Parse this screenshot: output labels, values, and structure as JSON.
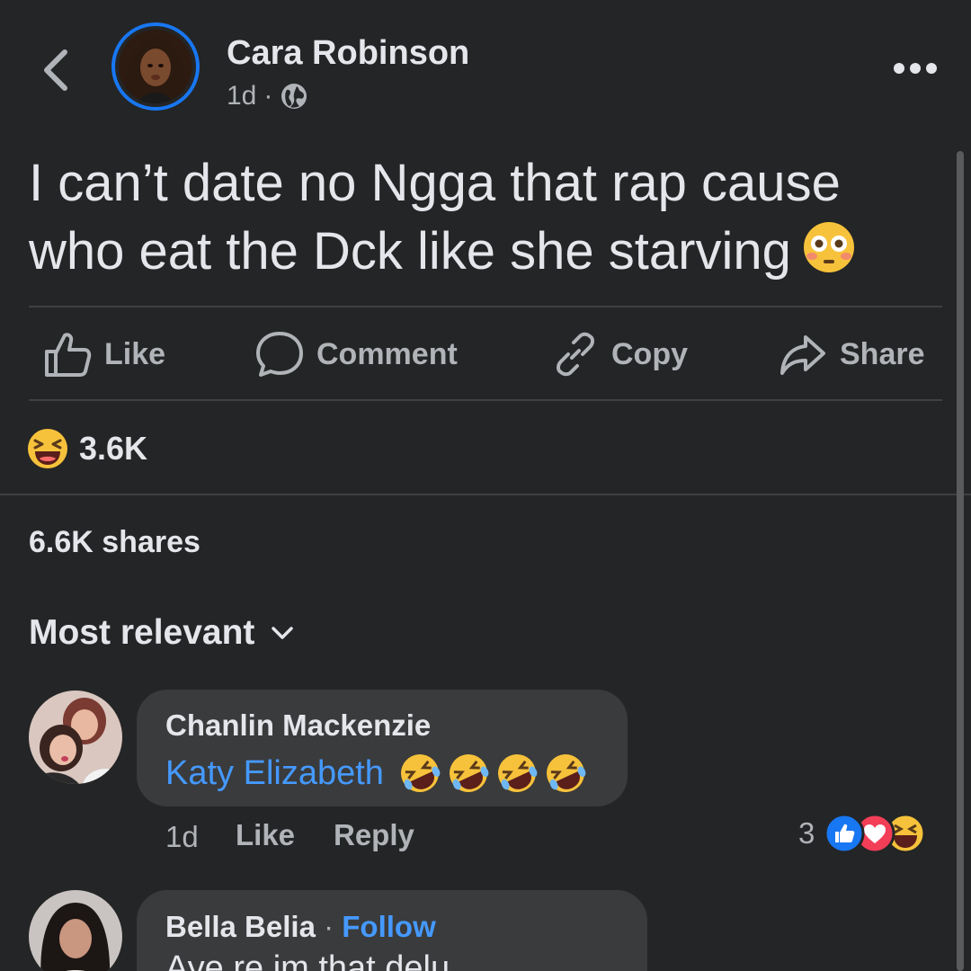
{
  "post": {
    "author": "Cara Robinson",
    "time": "1d",
    "separator": "·",
    "text": "I can’t date no Ngga that rap cause who eat the Dck like she starving",
    "text_emoji": "flushed-face-icon"
  },
  "actions": {
    "like": "Like",
    "comment": "Comment",
    "copy": "Copy",
    "share": "Share"
  },
  "reactions": {
    "icon": "laughing-face-icon",
    "count": "3.6K"
  },
  "shares": "6.6K shares",
  "sort": {
    "label": "Most relevant"
  },
  "comments": [
    {
      "author": "Chanlin Mackenzie",
      "mention": "Katy Elizabeth",
      "emojis": [
        "rofl-icon",
        "rofl-icon",
        "rofl-icon",
        "rofl-icon"
      ],
      "time": "1d",
      "like": "Like",
      "reply": "Reply",
      "reaction_count": "3",
      "reaction_icons": [
        "like-reaction-icon",
        "love-reaction-icon",
        "haha-reaction-icon"
      ]
    },
    {
      "author": "Bella Belia",
      "separator": "·",
      "follow": "Follow",
      "text_partial": "Aye re im that delu"
    }
  ],
  "colors": {
    "background": "#242526",
    "accent": "#1877f2",
    "link": "#4599ff",
    "bubble": "#3a3b3c",
    "text": "#e4e6eb",
    "secondary": "#b0b3b8"
  }
}
